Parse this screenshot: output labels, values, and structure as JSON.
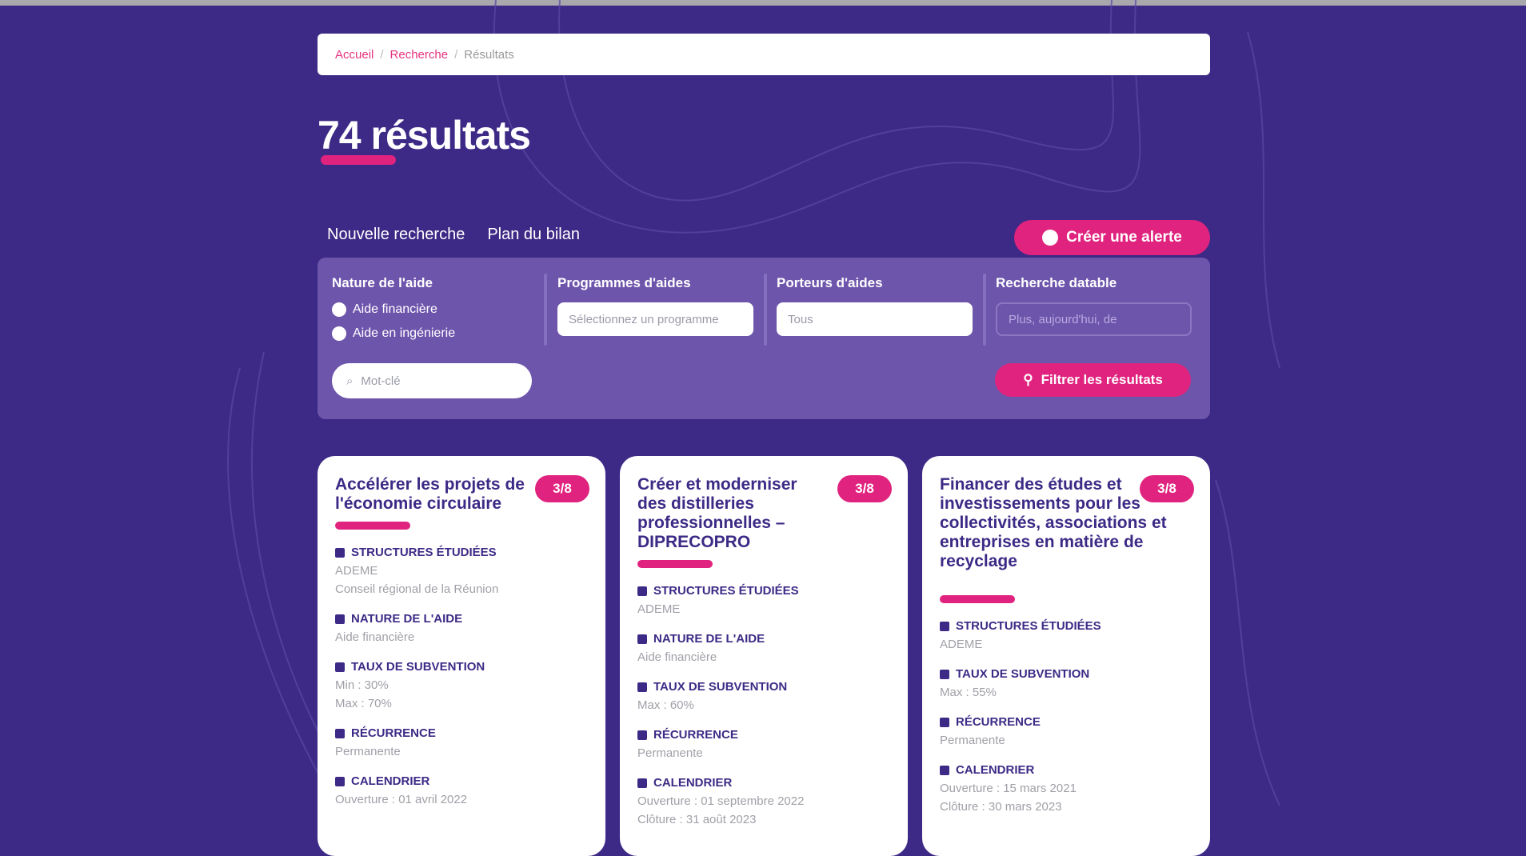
{
  "breadcrumb": {
    "home": "Accueil",
    "parent": "Recherche",
    "current": "Résultats"
  },
  "page": {
    "title": "74 résultats"
  },
  "tabs": [
    {
      "label": "Nouvelle recherche"
    },
    {
      "label": "Plan du bilan"
    }
  ],
  "actions": {
    "create_alert": "Créer une alerte",
    "reset_filters": "Filtrer les résultats"
  },
  "filters": {
    "nature": {
      "label": "Nature de l'aide",
      "options": [
        "Aide financière",
        "Aide en ingénierie"
      ]
    },
    "program": {
      "label": "Programmes d'aides",
      "placeholder": "Sélectionnez un programme"
    },
    "porteur": {
      "label": "Porteurs d'aides",
      "placeholder": "Tous"
    },
    "date": {
      "label": "Recherche datable",
      "placeholder": "Plus, aujourd'hui, de"
    },
    "keyword": {
      "placeholder": "Mot-clé"
    }
  },
  "cards": [
    {
      "title": "Accélérer les projets de l'économie circulaire",
      "badge": "3/8",
      "sections": [
        {
          "head": "STRUCTURES ÉTUDIÉES",
          "lines": [
            "ADEME",
            "Conseil régional de la Réunion"
          ]
        },
        {
          "head": "NATURE DE L'AIDE",
          "lines": [
            "Aide financière"
          ]
        },
        {
          "head": "TAUX DE SUBVENTION",
          "lines": [
            "Min : 30%",
            "Max : 70%"
          ]
        },
        {
          "head": "RÉCURRENCE",
          "lines": [
            "Permanente"
          ]
        },
        {
          "head": "CALENDRIER",
          "lines": [
            "Ouverture : 01 avril 2022"
          ]
        }
      ]
    },
    {
      "title": "Créer et moderniser des distilleries professionnelles – DIPRECOPRO",
      "badge": "3/8",
      "sections": [
        {
          "head": "STRUCTURES ÉTUDIÉES",
          "lines": [
            "ADEME"
          ]
        },
        {
          "head": "NATURE DE L'AIDE",
          "lines": [
            "Aide financière"
          ]
        },
        {
          "head": "TAUX DE SUBVENTION",
          "lines": [
            "Max : 60%"
          ]
        },
        {
          "head": "RÉCURRENCE",
          "lines": [
            "Permanente"
          ]
        },
        {
          "head": "CALENDRIER",
          "lines": [
            "Ouverture : 01 septembre 2022",
            "Clôture : 31 août 2023"
          ]
        }
      ]
    },
    {
      "title": "Financer des études et investissements pour les collectivités, associations et entreprises en matière de recyclage",
      "badge": "3/8",
      "sections": [
        {
          "head": "STRUCTURES ÉTUDIÉES",
          "lines": [
            "ADEME"
          ]
        },
        {
          "head": "TAUX DE SUBVENTION",
          "lines": [
            "Max : 55%"
          ]
        },
        {
          "head": "RÉCURRENCE",
          "lines": [
            "Permanente"
          ]
        },
        {
          "head": "CALENDRIER",
          "lines": [
            "Ouverture : 15 mars 2021",
            "Clôture : 30 mars 2023"
          ]
        }
      ]
    }
  ]
}
